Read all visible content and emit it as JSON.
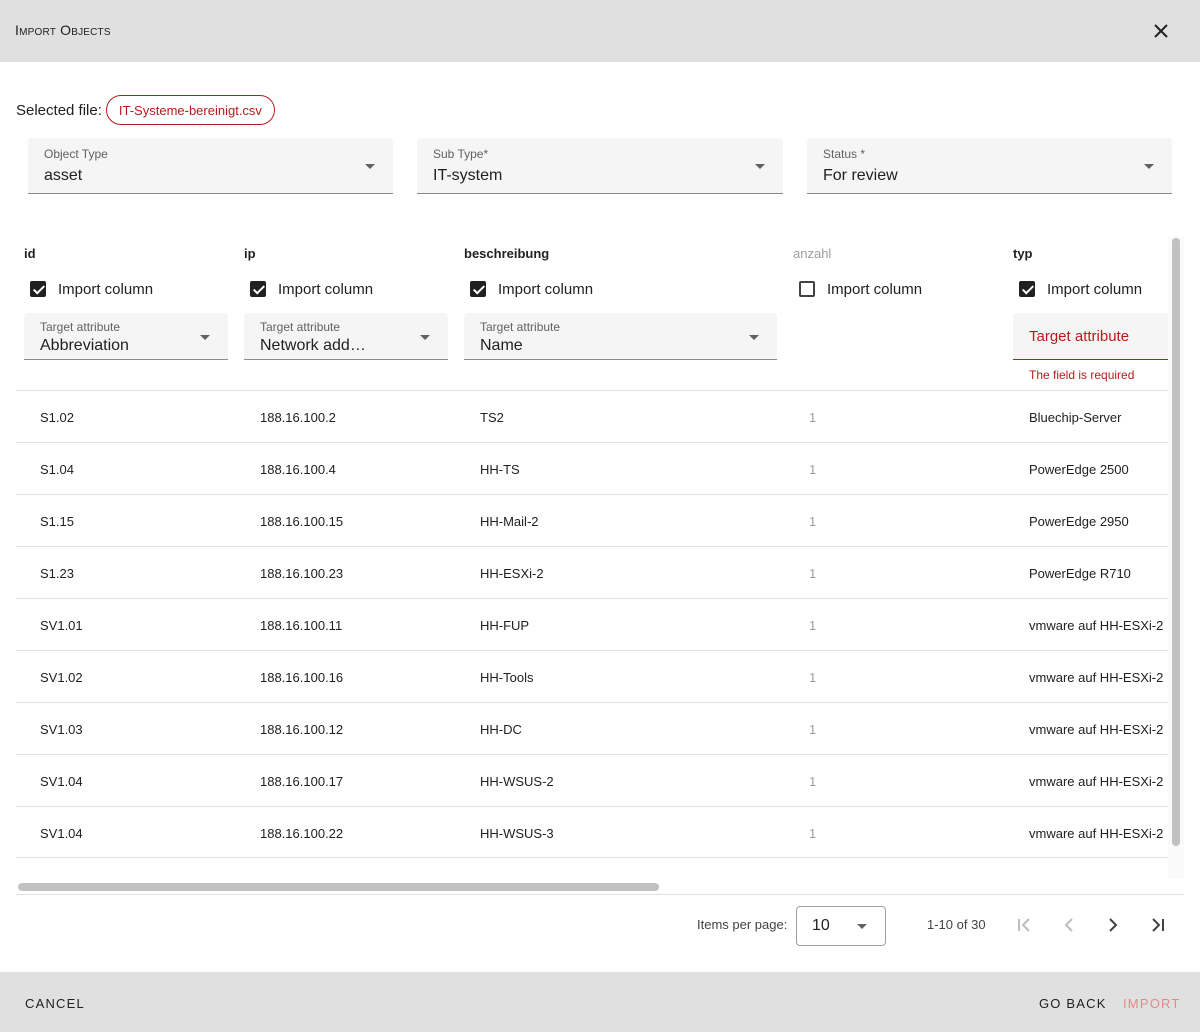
{
  "dialog": {
    "title": "Import Objects",
    "selected_file_label": "Selected file:",
    "selected_file": "IT-Systeme-bereinigt.csv"
  },
  "fields": {
    "object_type": {
      "label": "Object Type",
      "value": "asset"
    },
    "sub_type": {
      "label": "Sub Type*",
      "value": "IT-system"
    },
    "status": {
      "label": "Status *",
      "value": "For review"
    }
  },
  "columns": [
    {
      "name": "id",
      "import_label": "Import column",
      "checked": true,
      "target_label": "Target attribute",
      "target_value": "Abbreviation"
    },
    {
      "name": "ip",
      "import_label": "Import column",
      "checked": true,
      "target_label": "Target attribute",
      "target_value": "Network add…"
    },
    {
      "name": "beschreibung",
      "import_label": "Import column",
      "checked": true,
      "target_label": "Target attribute",
      "target_value": "Name"
    },
    {
      "name": "anzahl",
      "import_label": "Import column",
      "checked": false
    },
    {
      "name": "typ",
      "import_label": "Import column",
      "checked": true,
      "target_placeholder": "Target attribute",
      "error": "The field is required"
    }
  ],
  "rows": [
    {
      "id": "S1.02",
      "ip": "188.16.100.2",
      "beschreibung": "TS2",
      "anzahl": "1",
      "typ": "Bluechip-Server"
    },
    {
      "id": "S1.04",
      "ip": "188.16.100.4",
      "beschreibung": "HH-TS",
      "anzahl": "1",
      "typ": "PowerEdge 2500"
    },
    {
      "id": "S1.15",
      "ip": "188.16.100.15",
      "beschreibung": "HH-Mail-2",
      "anzahl": "1",
      "typ": "PowerEdge 2950"
    },
    {
      "id": "S1.23",
      "ip": "188.16.100.23",
      "beschreibung": "HH-ESXi-2",
      "anzahl": "1",
      "typ": "PowerEdge R710"
    },
    {
      "id": "SV1.01",
      "ip": "188.16.100.11",
      "beschreibung": "HH-FUP",
      "anzahl": "1",
      "typ": "vmware auf HH-ESXi-2"
    },
    {
      "id": "SV1.02",
      "ip": "188.16.100.16",
      "beschreibung": "HH-Tools",
      "anzahl": "1",
      "typ": "vmware auf HH-ESXi-2"
    },
    {
      "id": "SV1.03",
      "ip": "188.16.100.12",
      "beschreibung": "HH-DC",
      "anzahl": "1",
      "typ": "vmware auf HH-ESXi-2"
    },
    {
      "id": "SV1.04",
      "ip": "188.16.100.17",
      "beschreibung": "HH-WSUS-2",
      "anzahl": "1",
      "typ": "vmware auf HH-ESXi-2"
    },
    {
      "id": "SV1.04",
      "ip": "188.16.100.22",
      "beschreibung": "HH-WSUS-3",
      "anzahl": "1",
      "typ": "vmware auf HH-ESXi-2"
    }
  ],
  "paginator": {
    "items_per_page_label": "Items per page:",
    "items_per_page": "10",
    "range": "1-10 of 30"
  },
  "footer": {
    "cancel": "CANCEL",
    "go_back": "GO BACK",
    "import": "IMPORT"
  },
  "colors": {
    "accent": "#b71c1c",
    "header_bg": "#e0e0e0",
    "field_bg": "#f5f5f5"
  }
}
